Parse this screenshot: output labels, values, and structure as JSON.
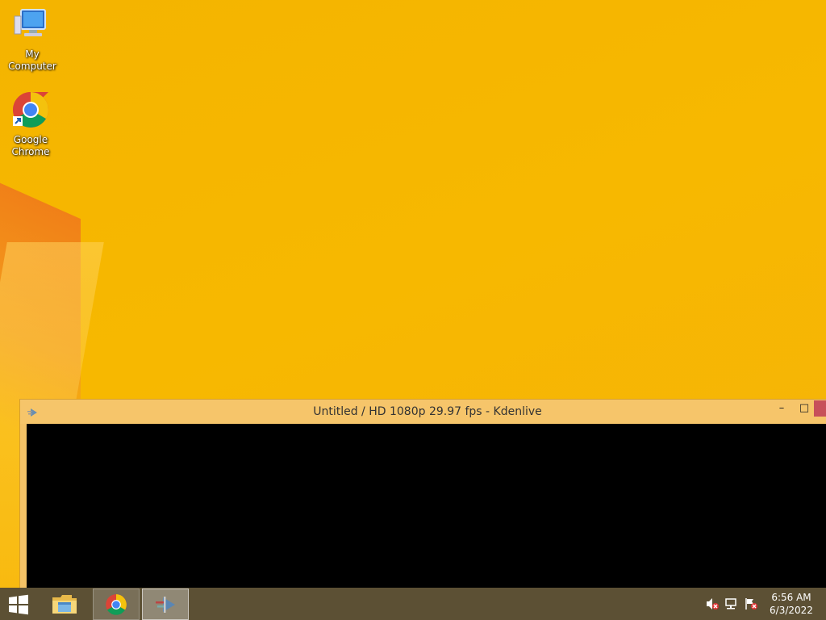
{
  "desktop": {
    "icons": [
      {
        "label": "My Computer",
        "icon": "computer-icon"
      },
      {
        "label": "Google\nChrome",
        "label_line1": "Google",
        "label_line2": "Chrome",
        "icon": "chrome-icon"
      }
    ]
  },
  "window": {
    "title": "Untitled / HD 1080p 29.97 fps - Kdenlive",
    "min_symbol": "–",
    "max_symbol": "□",
    "colors": {
      "titlebar": "#f6c56a",
      "close": "#c7505a",
      "content": "#000000"
    }
  },
  "taskbar": {
    "items": [
      {
        "name": "File Explorer",
        "icon": "folder-icon"
      },
      {
        "name": "Google Chrome",
        "icon": "chrome-icon"
      },
      {
        "name": "Kdenlive",
        "icon": "kdenlive-icon"
      }
    ],
    "tray": [
      "volume-muted-icon",
      "network-icon",
      "action-center-flag-icon"
    ],
    "clock": {
      "time": "6:56 AM",
      "date": "6/3/2022"
    },
    "color": "#5c5034"
  }
}
